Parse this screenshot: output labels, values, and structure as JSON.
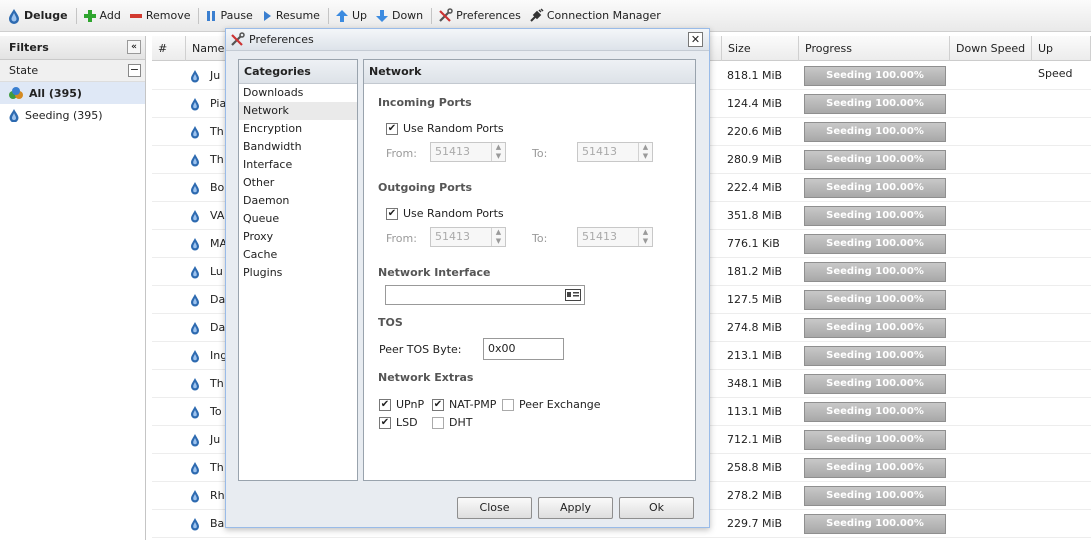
{
  "toolbar": {
    "app": "Deluge",
    "add": "Add",
    "remove": "Remove",
    "pause": "Pause",
    "resume": "Resume",
    "up": "Up",
    "down": "Down",
    "preferences": "Preferences",
    "connection_manager": "Connection Manager"
  },
  "filters": {
    "title": "Filters",
    "state_label": "State",
    "items": [
      {
        "label": "All (395)"
      },
      {
        "label": "Seeding (395)"
      }
    ]
  },
  "grid": {
    "columns": {
      "num": "#",
      "name": "Name",
      "size": "Size",
      "progress": "Progress",
      "down_speed": "Down Speed",
      "up_speed": "Up Speed"
    },
    "rows": [
      {
        "name": "Ju",
        "size": "818.1 MiB",
        "progress": "Seeding 100.00%"
      },
      {
        "name": "Pia",
        "size": "124.4 MiB",
        "progress": "Seeding 100.00%"
      },
      {
        "name": "Th",
        "size": "220.6 MiB",
        "progress": "Seeding 100.00%"
      },
      {
        "name": "Th",
        "size": "280.9 MiB",
        "progress": "Seeding 100.00%"
      },
      {
        "name": "Bo",
        "size": "222.4 MiB",
        "progress": "Seeding 100.00%"
      },
      {
        "name": "VA",
        "size": "351.8 MiB",
        "progress": "Seeding 100.00%"
      },
      {
        "name": "MA",
        "size": "776.1 KiB",
        "progress": "Seeding 100.00%"
      },
      {
        "name": "Lu",
        "size": "181.2 MiB",
        "progress": "Seeding 100.00%"
      },
      {
        "name": "Da",
        "size": "127.5 MiB",
        "progress": "Seeding 100.00%"
      },
      {
        "name": "Da",
        "size": "274.8 MiB",
        "progress": "Seeding 100.00%"
      },
      {
        "name": "Ing",
        "size": "213.1 MiB",
        "progress": "Seeding 100.00%"
      },
      {
        "name": "Th",
        "size": "348.1 MiB",
        "progress": "Seeding 100.00%"
      },
      {
        "name": "To",
        "size": "113.1 MiB",
        "progress": "Seeding 100.00%"
      },
      {
        "name": "Ju",
        "size": "712.1 MiB",
        "progress": "Seeding 100.00%"
      },
      {
        "name": "Th",
        "size": "258.8 MiB",
        "progress": "Seeding 100.00%"
      },
      {
        "name": "Rh",
        "size": "278.2 MiB",
        "progress": "Seeding 100.00%"
      },
      {
        "name": "Ba",
        "size": "229.7 MiB",
        "progress": "Seeding 100.00%"
      }
    ]
  },
  "dialog": {
    "title": "Preferences",
    "categories_title": "Categories",
    "categories": [
      "Downloads",
      "Network",
      "Encryption",
      "Bandwidth",
      "Interface",
      "Other",
      "Daemon",
      "Queue",
      "Proxy",
      "Cache",
      "Plugins"
    ],
    "selected_category": "Network",
    "panel_title": "Network",
    "incoming": {
      "title": "Incoming Ports",
      "random_label": "Use Random Ports",
      "from_label": "From:",
      "from_value": "51413",
      "to_label": "To:",
      "to_value": "51413"
    },
    "outgoing": {
      "title": "Outgoing Ports",
      "random_label": "Use Random Ports",
      "from_label": "From:",
      "from_value": "51413",
      "to_label": "To:",
      "to_value": "51413"
    },
    "interface": {
      "title": "Network Interface",
      "value": ""
    },
    "tos": {
      "title": "TOS",
      "label": "Peer TOS Byte:",
      "value": "0x00"
    },
    "extras": {
      "title": "Network Extras",
      "upnp": "UPnP",
      "natpmp": "NAT-PMP",
      "pex": "Peer Exchange",
      "lsd": "LSD",
      "dht": "DHT"
    },
    "buttons": {
      "close": "Close",
      "apply": "Apply",
      "ok": "Ok"
    }
  }
}
